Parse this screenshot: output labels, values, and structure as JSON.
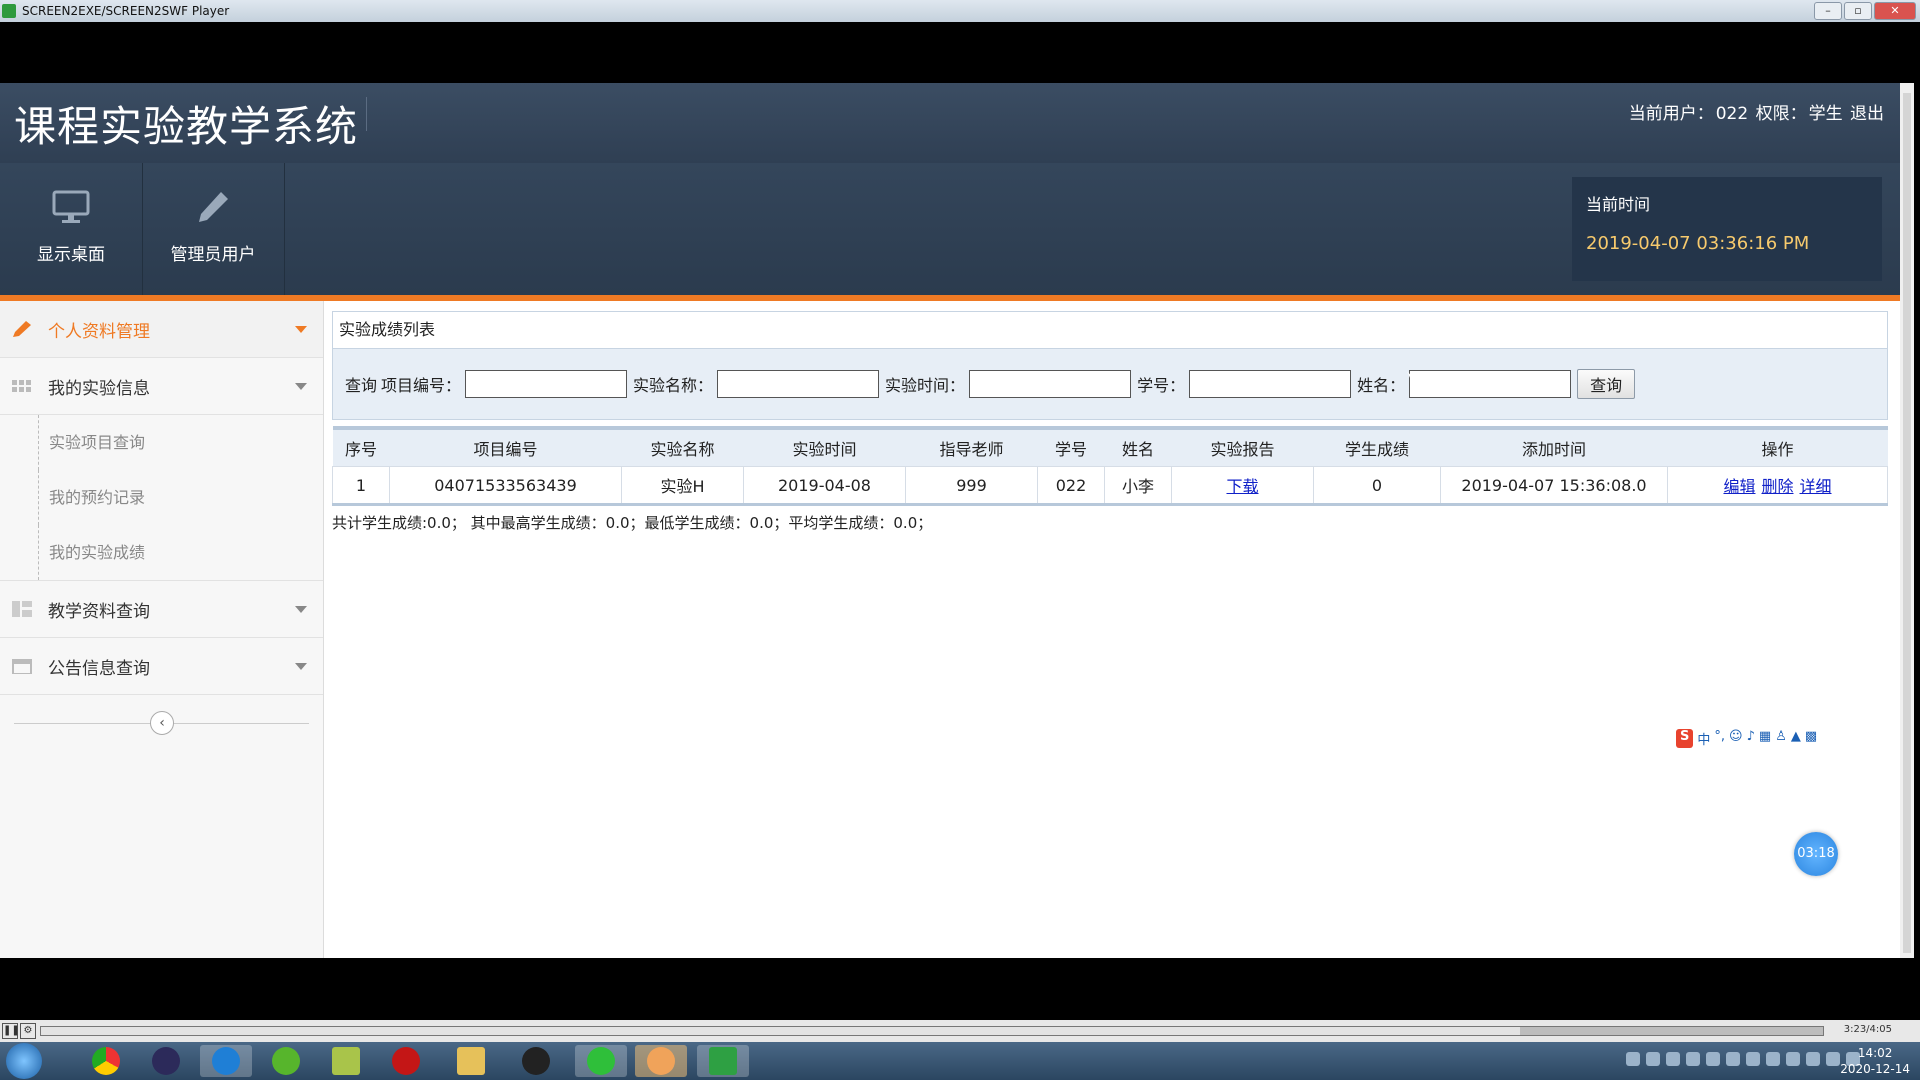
{
  "player": {
    "window_title": "SCREEN2EXE/SCREEN2SWF Player",
    "timecode": "3:23/4:05",
    "progress": 0.83
  },
  "header": {
    "system_title": "课程实验教学系统",
    "user_label": "当前用户：",
    "user_value": "022",
    "role_label": "权限：",
    "role_value": "学生",
    "logout": "退出"
  },
  "nav": {
    "show_desktop": "显示桌面",
    "admin_user": "管理员用户"
  },
  "time_box": {
    "label": "当前时间",
    "value": "2019-04-07 03:36:16 PM"
  },
  "sidebar": {
    "items": [
      {
        "label": "个人资料管理",
        "icon": "pencil-icon",
        "active": true
      },
      {
        "label": "我的实验信息",
        "icon": "grid-icon",
        "active": false
      },
      {
        "label": "教学资料查询",
        "icon": "list-icon",
        "active": false
      },
      {
        "label": "公告信息查询",
        "icon": "calendar-icon",
        "active": false
      }
    ],
    "sub_items": [
      "实验项目查询",
      "我的预约记录",
      "我的实验成绩"
    ],
    "collapse_symbol": "‹"
  },
  "panel": {
    "title": "实验成绩列表"
  },
  "search": {
    "query_label": "查询",
    "project_no_label": "项目编号：",
    "exp_name_label": "实验名称：",
    "exp_time_label": "实验时间：",
    "student_no_label": "学号：",
    "name_label": "姓名：",
    "button": "查询"
  },
  "table": {
    "headers": [
      "序号",
      "项目编号",
      "实验名称",
      "实验时间",
      "指导老师",
      "学号",
      "姓名",
      "实验报告",
      "学生成绩",
      "添加时间",
      "操作"
    ],
    "rows": [
      {
        "index": "1",
        "project_no": "04071533563439",
        "exp_name": "实验H",
        "exp_time": "2019-04-08",
        "teacher": "999",
        "student_no": "022",
        "name": "小李",
        "report": "下载",
        "score": "0",
        "added": "2019-04-07 15:36:08.0",
        "op_edit": "编辑",
        "op_delete": "删除",
        "op_detail": "详细"
      }
    ]
  },
  "summary": "共计学生成绩:0.0； 其中最高学生成绩：0.0；最低学生成绩：0.0；平均学生成绩：0.0；",
  "timer_badge": "03:18",
  "ime": {
    "logo": "S",
    "mode": "中"
  },
  "taskbar": {
    "clock_time": "14:02",
    "clock_date": "2020-12-14"
  },
  "colors": {
    "header_bg": "#34465b",
    "accent_orange": "#ef7a24",
    "time_text": "#f7ca6d",
    "link_blue": "#1020c8"
  }
}
